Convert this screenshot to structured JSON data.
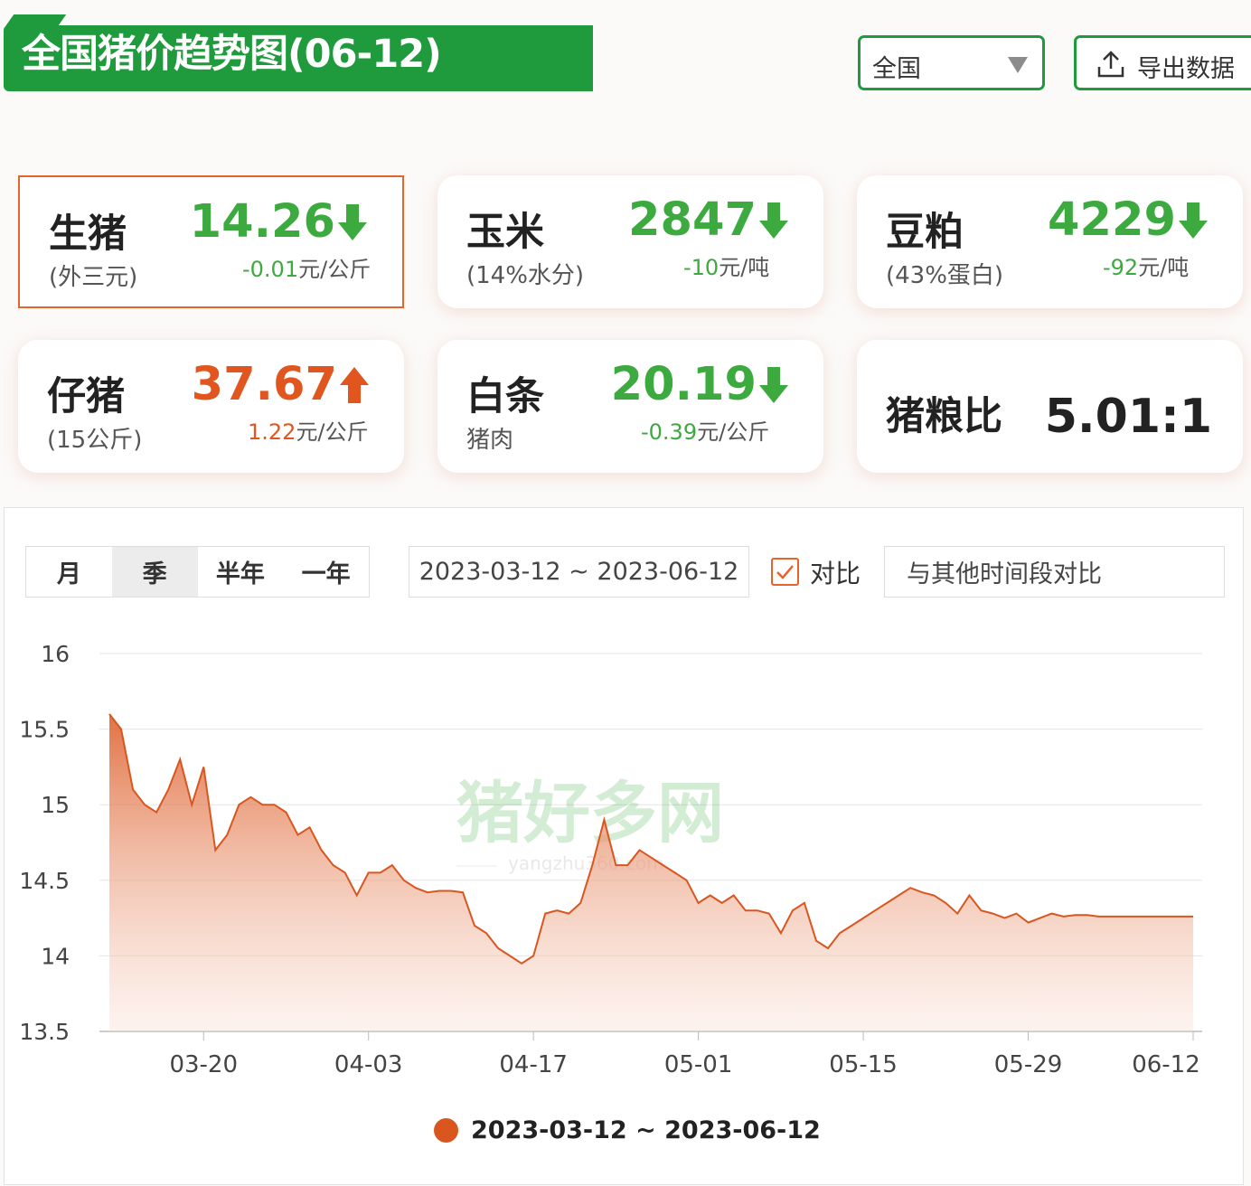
{
  "header": {
    "title": "全国猪价趋势图(06-12)",
    "region": "全国",
    "export_label": "导出数据"
  },
  "cards": [
    {
      "name": "生猪",
      "sub": "(外三元)",
      "price": "14.26",
      "trend": "down",
      "change": "-0.01",
      "unit": "元/公斤",
      "selected": true
    },
    {
      "name": "玉米",
      "sub": "(14%水分)",
      "price": "2847",
      "trend": "down",
      "change": "-10",
      "unit": "元/吨"
    },
    {
      "name": "豆粕",
      "sub": "(43%蛋白)",
      "price": "4229",
      "trend": "down",
      "change": "-92",
      "unit": "元/吨"
    },
    {
      "name": "仔猪",
      "sub": "(15公斤)",
      "price": "37.67",
      "trend": "up",
      "change": "1.22",
      "unit": "元/公斤"
    },
    {
      "name": "白条",
      "sub": "猪肉",
      "price": "20.19",
      "trend": "down",
      "change": "-0.39",
      "unit": "元/公斤"
    },
    {
      "name": "猪粮比",
      "ratio": "5.01:1"
    }
  ],
  "controls": {
    "tabs": [
      "月",
      "季",
      "半年",
      "一年"
    ],
    "active_tab": "季",
    "date_range": "2023-03-12 ~ 2023-06-12",
    "compare_label": "对比",
    "compare_checked": true,
    "compare_placeholder": "与其他时间段对比"
  },
  "colors": {
    "brand_green": "#1f9b3d",
    "down_green": "#3caa3f",
    "up_orange": "#e0561e",
    "series": "#d9561f"
  },
  "chart_data": {
    "type": "area",
    "y_ticks": [
      16,
      15.5,
      15,
      14.5,
      14,
      13.5
    ],
    "ylim": [
      13.5,
      16
    ],
    "x_ticks": [
      "03-20",
      "04-03",
      "04-17",
      "05-01",
      "05-15",
      "05-29",
      "06-12"
    ],
    "grid": true,
    "legend_position": "bottom",
    "series": [
      {
        "name": "2023-03-12 ~ 2023-06-12",
        "x": [
          "03-12",
          "03-13",
          "03-14",
          "03-15",
          "03-16",
          "03-17",
          "03-18",
          "03-19",
          "03-20",
          "03-21",
          "03-22",
          "03-23",
          "03-24",
          "03-25",
          "03-26",
          "03-27",
          "03-28",
          "03-29",
          "03-30",
          "03-31",
          "04-01",
          "04-02",
          "04-03",
          "04-04",
          "04-05",
          "04-06",
          "04-07",
          "04-08",
          "04-09",
          "04-10",
          "04-11",
          "04-12",
          "04-13",
          "04-14",
          "04-15",
          "04-16",
          "04-17",
          "04-18",
          "04-19",
          "04-20",
          "04-21",
          "04-22",
          "04-23",
          "04-24",
          "04-25",
          "04-26",
          "04-27",
          "04-28",
          "04-29",
          "04-30",
          "05-01",
          "05-02",
          "05-03",
          "05-04",
          "05-05",
          "05-06",
          "05-07",
          "05-08",
          "05-09",
          "05-10",
          "05-11",
          "05-12",
          "05-13",
          "05-14",
          "05-15",
          "05-16",
          "05-17",
          "05-18",
          "05-19",
          "05-20",
          "05-21",
          "05-22",
          "05-23",
          "05-24",
          "05-25",
          "05-26",
          "05-27",
          "05-28",
          "05-29",
          "05-30",
          "05-31",
          "06-01",
          "06-02",
          "06-03",
          "06-04",
          "06-05",
          "06-06",
          "06-07",
          "06-08",
          "06-09",
          "06-10",
          "06-11",
          "06-12"
        ],
        "values": [
          15.6,
          15.5,
          15.1,
          15.0,
          14.95,
          15.1,
          15.3,
          15.0,
          15.25,
          14.7,
          14.8,
          15.0,
          15.05,
          15.0,
          15.0,
          14.95,
          14.8,
          14.85,
          14.7,
          14.6,
          14.55,
          14.4,
          14.55,
          14.55,
          14.6,
          14.5,
          14.45,
          14.42,
          14.43,
          14.43,
          14.42,
          14.2,
          14.15,
          14.05,
          14.0,
          13.95,
          14.0,
          14.28,
          14.3,
          14.28,
          14.35,
          14.6,
          14.9,
          14.6,
          14.6,
          14.7,
          14.65,
          14.6,
          14.55,
          14.5,
          14.35,
          14.4,
          14.35,
          14.4,
          14.3,
          14.3,
          14.28,
          14.15,
          14.3,
          14.35,
          14.1,
          14.05,
          14.15,
          14.2,
          14.25,
          14.3,
          14.35,
          14.4,
          14.45,
          14.42,
          14.4,
          14.35,
          14.28,
          14.4,
          14.3,
          14.28,
          14.25,
          14.28,
          14.22,
          14.25,
          14.28,
          14.26,
          14.27,
          14.27,
          14.26,
          14.26,
          14.26,
          14.26,
          14.26,
          14.26,
          14.26,
          14.26,
          14.26
        ]
      }
    ]
  }
}
